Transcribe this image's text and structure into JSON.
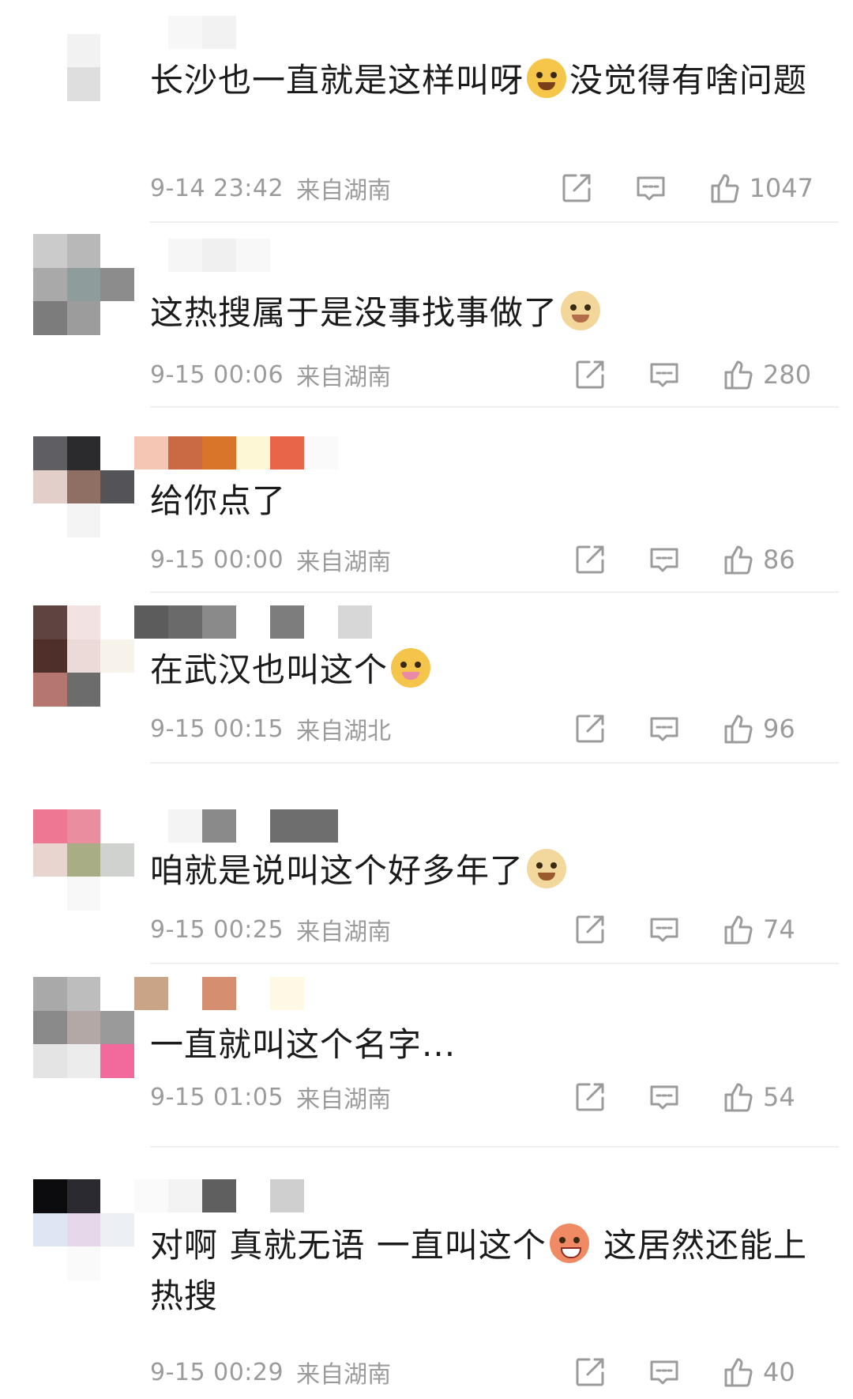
{
  "comments": [
    {
      "text_a": "长沙也一直就是这样叫呀",
      "emoji": "laughing-crying-emoji",
      "text_b": "没觉得有啥问题",
      "time": "9-14 23:42",
      "location": "来自湖南",
      "likes": "1047"
    },
    {
      "text_a": "这热搜属于是没事找事做了",
      "emoji": "doge-tearful-emoji",
      "text_b": "",
      "time": "9-15 00:06",
      "location": "来自湖南",
      "likes": "280"
    },
    {
      "text_a": "给你点了",
      "emoji": "",
      "text_b": "",
      "time": "9-15 00:00",
      "location": "来自湖南",
      "likes": "86"
    },
    {
      "text_a": "在武汉也叫这个",
      "emoji": "flower-hug-emoji",
      "text_b": "",
      "time": "9-15 00:15",
      "location": "来自湖北",
      "likes": "96"
    },
    {
      "text_a": "咱就是说叫这个好多年了",
      "emoji": "doge-emoji",
      "text_b": "",
      "time": "9-15 00:25",
      "location": "来自湖南",
      "likes": "74"
    },
    {
      "text_a": "一直就叫这个名字...",
      "emoji": "",
      "text_b": "",
      "time": "9-15 01:05",
      "location": "来自湖南",
      "likes": "54"
    },
    {
      "text_a": "对啊 真就无语 一直叫这个",
      "emoji": "grinning-sweat-emoji",
      "text_b": " 这居然还能上热搜",
      "time": "9-15 00:29",
      "location": "来自湖南",
      "likes": "40"
    }
  ],
  "colors": {
    "text": "#1b1b1b",
    "meta": "#9b9b9b",
    "divider": "#eeeeee",
    "avatar_mosaics": [
      [
        "#ffffff",
        "#ffffff",
        "#ffffff",
        "#ffffff",
        "#f2f2f2",
        "#ffffff",
        "#ffffff",
        "#dedede",
        "#ffffff"
      ],
      [
        "#cbcbcb",
        "#b8b8b8",
        "#ffffff",
        "#a9a9a9",
        "#8f9c9c",
        "#8c8c8c",
        "#7c7c7c",
        "#9c9c9c",
        "#ffffff"
      ],
      [
        "#5f5e63",
        "#2b2a2d",
        "#ffffff",
        "#e2cfca",
        "#8f6f64",
        "#545458",
        "#ffffff",
        "#f4f4f4",
        "#ffffff"
      ],
      [
        "#5d4440",
        "#f2e3e2",
        "#ffffff",
        "#4e2f29",
        "#ecdad9",
        "#f7f3ea",
        "#b47770",
        "#6c6c6c",
        "#ffffff"
      ],
      [
        "#ee7793",
        "#ea8e9f",
        "#ffffff",
        "#e9d5cf",
        "#a9ad86",
        "#cfd2ce",
        "#ffffff",
        "#f8f8f8",
        "#ffffff"
      ],
      [
        "#a9a9a9",
        "#bdbdbd",
        "#ffffff",
        "#8a8a8a",
        "#b3a8a6",
        "#9a9a9a",
        "#e4e4e4",
        "#ececec",
        "#f26a9b"
      ],
      [
        "#0c0c0e",
        "#2b2a30",
        "#ffffff",
        "#dfe6f3",
        "#e7d7ea",
        "#eceff4",
        "#ffffff",
        "#fafafa",
        "#ffffff"
      ]
    ],
    "username_mosaics": [
      [
        "#ffffff",
        "#f7f7f7",
        "#f2f2f2",
        "#ffffff"
      ],
      [
        "#ffffff",
        "#f6f6f6",
        "#f0f0f0",
        "#f8f8f8",
        "#ffffff",
        "#ffffff"
      ],
      [
        "#f5c6b4",
        "#c96a45",
        "#d9742b",
        "#fdf7d6",
        "#e8654a",
        "#fafafa"
      ],
      [
        "#5c5c5c",
        "#6a6a6a",
        "#8a8a8a",
        "#ffffff",
        "#7d7d7d",
        "#ffffff",
        "#d7d7d7"
      ],
      [
        "#ffffff",
        "#f4f4f4",
        "#8a8a8a",
        "#ffffff",
        "#6e6e6e",
        "#6e6e6e"
      ],
      [
        "#caa487",
        "#ffffff",
        "#d58e70",
        "#ffffff",
        "#fdf9e4"
      ],
      [
        "#fafafa",
        "#f3f3f3",
        "#5f5f5f",
        "#ffffff",
        "#cfcfcf"
      ]
    ]
  }
}
